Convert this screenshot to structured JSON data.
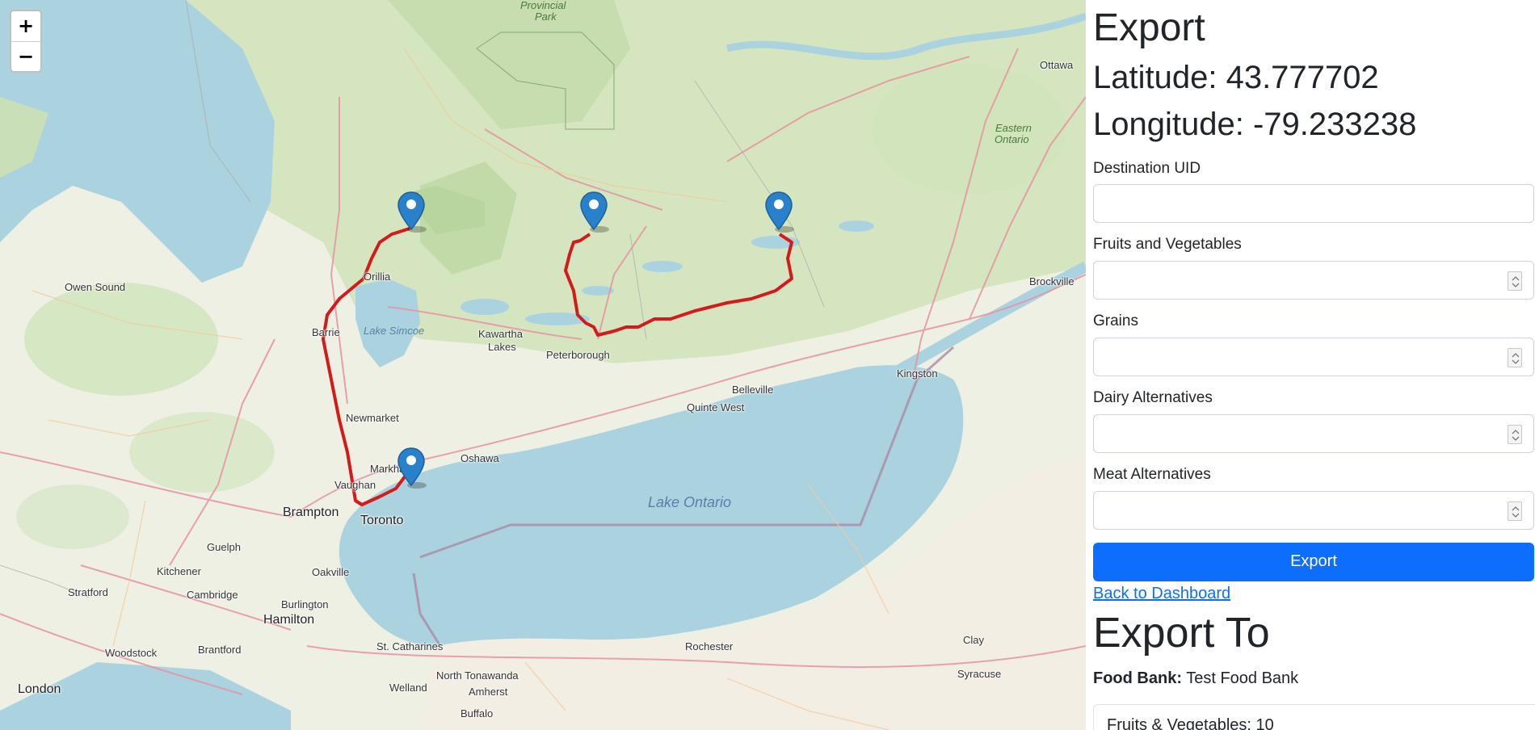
{
  "map": {
    "zoom_in": "+",
    "zoom_out": "−",
    "places": [
      {
        "name": "Provincial",
        "cls": "park"
      },
      {
        "name": "Park",
        "cls": "park"
      },
      {
        "name": "Ottawa",
        "cls": ""
      },
      {
        "name": "Eastern",
        "cls": "park"
      },
      {
        "name": "Ontario",
        "cls": "park"
      },
      {
        "name": "Owen Sound",
        "cls": ""
      },
      {
        "name": "Orillia",
        "cls": ""
      },
      {
        "name": "Barrie",
        "cls": ""
      },
      {
        "name": "Lake Simcoe",
        "cls": "water"
      },
      {
        "name": "Kawartha",
        "cls": ""
      },
      {
        "name": "Lakes",
        "cls": ""
      },
      {
        "name": "Peterborough",
        "cls": ""
      },
      {
        "name": "Brockville",
        "cls": ""
      },
      {
        "name": "Kingston",
        "cls": ""
      },
      {
        "name": "Belleville",
        "cls": ""
      },
      {
        "name": "Quinte West",
        "cls": ""
      },
      {
        "name": "Newmarket",
        "cls": ""
      },
      {
        "name": "Oshawa",
        "cls": ""
      },
      {
        "name": "Markham",
        "cls": ""
      },
      {
        "name": "Vaughan",
        "cls": ""
      },
      {
        "name": "Brampton",
        "cls": "city"
      },
      {
        "name": "Toronto",
        "cls": "city"
      },
      {
        "name": "Lake Ontario",
        "cls": "water lake-big"
      },
      {
        "name": "Guelph",
        "cls": ""
      },
      {
        "name": "Kitchener",
        "cls": ""
      },
      {
        "name": "Oakville",
        "cls": ""
      },
      {
        "name": "Stratford",
        "cls": ""
      },
      {
        "name": "Cambridge",
        "cls": ""
      },
      {
        "name": "Burlington",
        "cls": ""
      },
      {
        "name": "Hamilton",
        "cls": "city"
      },
      {
        "name": "Woodstock",
        "cls": ""
      },
      {
        "name": "Brantford",
        "cls": ""
      },
      {
        "name": "St. Catharines",
        "cls": ""
      },
      {
        "name": "Rochester",
        "cls": ""
      },
      {
        "name": "Clay",
        "cls": ""
      },
      {
        "name": "Syracuse",
        "cls": ""
      },
      {
        "name": "London",
        "cls": "city"
      },
      {
        "name": "North Tonawanda",
        "cls": ""
      },
      {
        "name": "Welland",
        "cls": ""
      },
      {
        "name": "Amherst",
        "cls": ""
      },
      {
        "name": "Buffalo",
        "cls": ""
      }
    ],
    "colors": {
      "water": "#aad3df",
      "land": "#f2efe9",
      "forest": "#cfe3b8",
      "route": "#d41a1a",
      "marker": "#2a81cb"
    }
  },
  "panel": {
    "title": "Export",
    "latitude": "Latitude: 43.777702",
    "longitude": "Longitude: -79.233238",
    "fields": [
      {
        "label": "Destination UID",
        "value": "",
        "type": "text"
      },
      {
        "label": "Fruits and Vegetables",
        "value": "",
        "type": "number"
      },
      {
        "label": "Grains",
        "value": "",
        "type": "number"
      },
      {
        "label": "Dairy Alternatives",
        "value": "",
        "type": "number"
      },
      {
        "label": "Meat Alternatives",
        "value": "",
        "type": "number"
      }
    ],
    "export_button": "Export",
    "back_link": "Back to Dashboard",
    "export_to_title": "Export To",
    "food_bank_label": "Food Bank:",
    "food_bank_value": "Test Food Bank",
    "inventory_first_item": "Fruits & Vegetables: 10"
  }
}
